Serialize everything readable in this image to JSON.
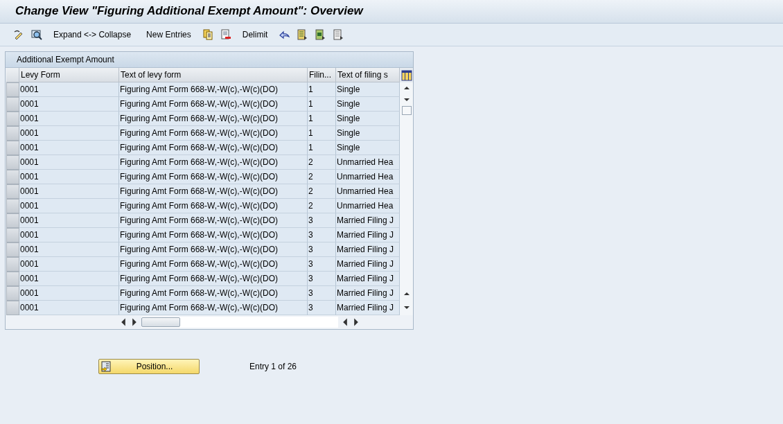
{
  "window": {
    "title": "Change View \"Figuring Additional Exempt Amount\": Overview"
  },
  "toolbar": [
    {
      "kind": "icon"
    },
    {
      "kind": "icon"
    },
    {
      "kind": "text",
      "label": "Expand <-> Collapse"
    },
    {
      "kind": "text",
      "label": "New Entries"
    },
    {
      "kind": "icon"
    },
    {
      "kind": "icon"
    },
    {
      "kind": "text",
      "label": "Delimit"
    },
    {
      "kind": "icon"
    },
    {
      "kind": "icon"
    },
    {
      "kind": "icon"
    },
    {
      "kind": "icon"
    }
  ],
  "table": {
    "title": "Additional Exempt Amount",
    "columns": [
      "Levy Form",
      "Text of levy form",
      "Filin...",
      "Text of filing s"
    ],
    "rows": [
      [
        "0001",
        "Figuring Amt Form 668-W,-W(c),-W(c)(DO)",
        "1",
        "Single"
      ],
      [
        "0001",
        "Figuring Amt Form 668-W,-W(c),-W(c)(DO)",
        "1",
        "Single"
      ],
      [
        "0001",
        "Figuring Amt Form 668-W,-W(c),-W(c)(DO)",
        "1",
        "Single"
      ],
      [
        "0001",
        "Figuring Amt Form 668-W,-W(c),-W(c)(DO)",
        "1",
        "Single"
      ],
      [
        "0001",
        "Figuring Amt Form 668-W,-W(c),-W(c)(DO)",
        "1",
        "Single"
      ],
      [
        "0001",
        "Figuring Amt Form 668-W,-W(c),-W(c)(DO)",
        "2",
        "Unmarried Hea"
      ],
      [
        "0001",
        "Figuring Amt Form 668-W,-W(c),-W(c)(DO)",
        "2",
        "Unmarried Hea"
      ],
      [
        "0001",
        "Figuring Amt Form 668-W,-W(c),-W(c)(DO)",
        "2",
        "Unmarried Hea"
      ],
      [
        "0001",
        "Figuring Amt Form 668-W,-W(c),-W(c)(DO)",
        "2",
        "Unmarried Hea"
      ],
      [
        "0001",
        "Figuring Amt Form 668-W,-W(c),-W(c)(DO)",
        "3",
        "Married Filing J"
      ],
      [
        "0001",
        "Figuring Amt Form 668-W,-W(c),-W(c)(DO)",
        "3",
        "Married Filing J"
      ],
      [
        "0001",
        "Figuring Amt Form 668-W,-W(c),-W(c)(DO)",
        "3",
        "Married Filing J"
      ],
      [
        "0001",
        "Figuring Amt Form 668-W,-W(c),-W(c)(DO)",
        "3",
        "Married Filing J"
      ],
      [
        "0001",
        "Figuring Amt Form 668-W,-W(c),-W(c)(DO)",
        "3",
        "Married Filing J"
      ],
      [
        "0001",
        "Figuring Amt Form 668-W,-W(c),-W(c)(DO)",
        "3",
        "Married Filing J"
      ],
      [
        "0001",
        "Figuring Amt Form 668-W,-W(c),-W(c)(DO)",
        "3",
        "Married Filing J"
      ]
    ]
  },
  "footer": {
    "position_button": "Position...",
    "entry_info": "Entry 1 of 26"
  }
}
